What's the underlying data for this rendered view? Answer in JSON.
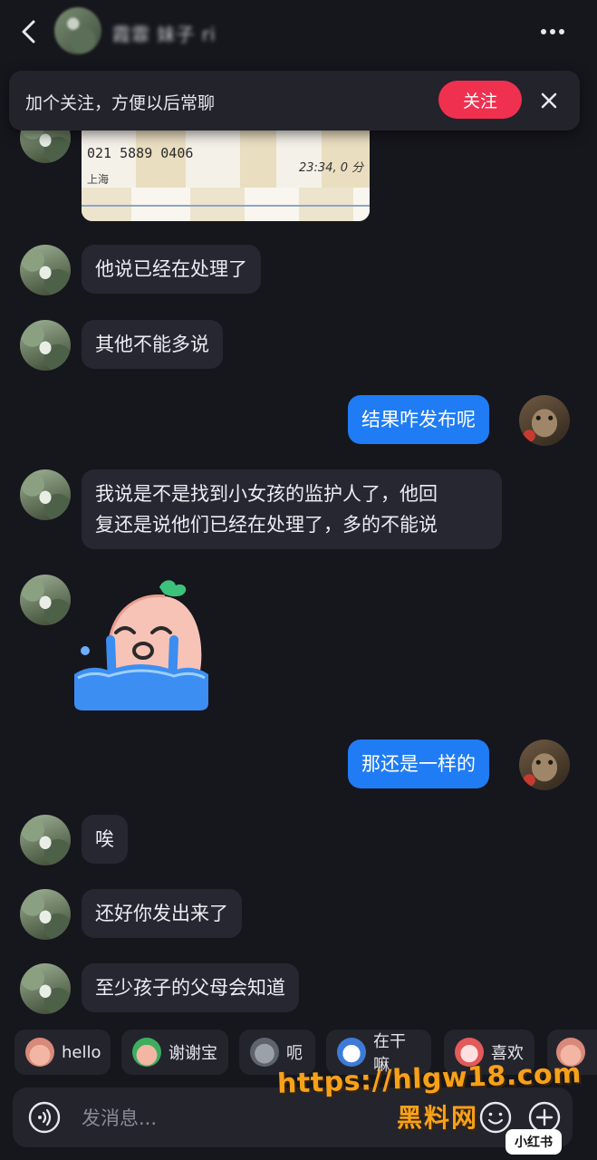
{
  "header": {
    "contact_name": "霞霏 妹子 ri",
    "back_icon": "chevron-left-icon",
    "more_icon": "more-horizontal-icon"
  },
  "follow_banner": {
    "text": "加个关注，方便以后常聊",
    "button_label": "关注",
    "button_color": "#f0304f",
    "close_icon": "close-icon"
  },
  "shared_image": {
    "phone": "021 5889 0406",
    "city": "上海",
    "time": "23:34, 0 分"
  },
  "messages": [
    {
      "side": "in",
      "text": "他说已经在处理了"
    },
    {
      "side": "in",
      "text": "其他不能多说"
    },
    {
      "side": "out",
      "text": "结果咋发布呢"
    },
    {
      "side": "in",
      "line1": "我说是不是找到小女孩的监护人了，他回",
      "line2": "复还是说他们已经在处理了，多的不能说"
    },
    {
      "side": "in",
      "sticker": "crying-sticker"
    },
    {
      "side": "out",
      "text": "那还是一样的"
    },
    {
      "side": "in",
      "text": "唉"
    },
    {
      "side": "in",
      "text": "还好你发出来了"
    },
    {
      "side": "in",
      "text": "至少孩子的父母会知道"
    }
  ],
  "quick_replies": [
    "hello",
    "谢谢宝",
    "呃",
    "在干嘛",
    "喜欢"
  ],
  "input": {
    "placeholder": "发消息...",
    "voice_icon": "voice-icon",
    "emoji_icon": "emoji-icon",
    "plus_icon": "plus-icon"
  },
  "watermark": {
    "url": "https://hlgw18.com",
    "site_name": "黑料网",
    "app_logo": "小红书"
  },
  "colors": {
    "background": "#16161d",
    "incoming_bubble": "#272731",
    "outgoing_bubble": "#1f7cf5",
    "watermark": "#f7a11a"
  }
}
